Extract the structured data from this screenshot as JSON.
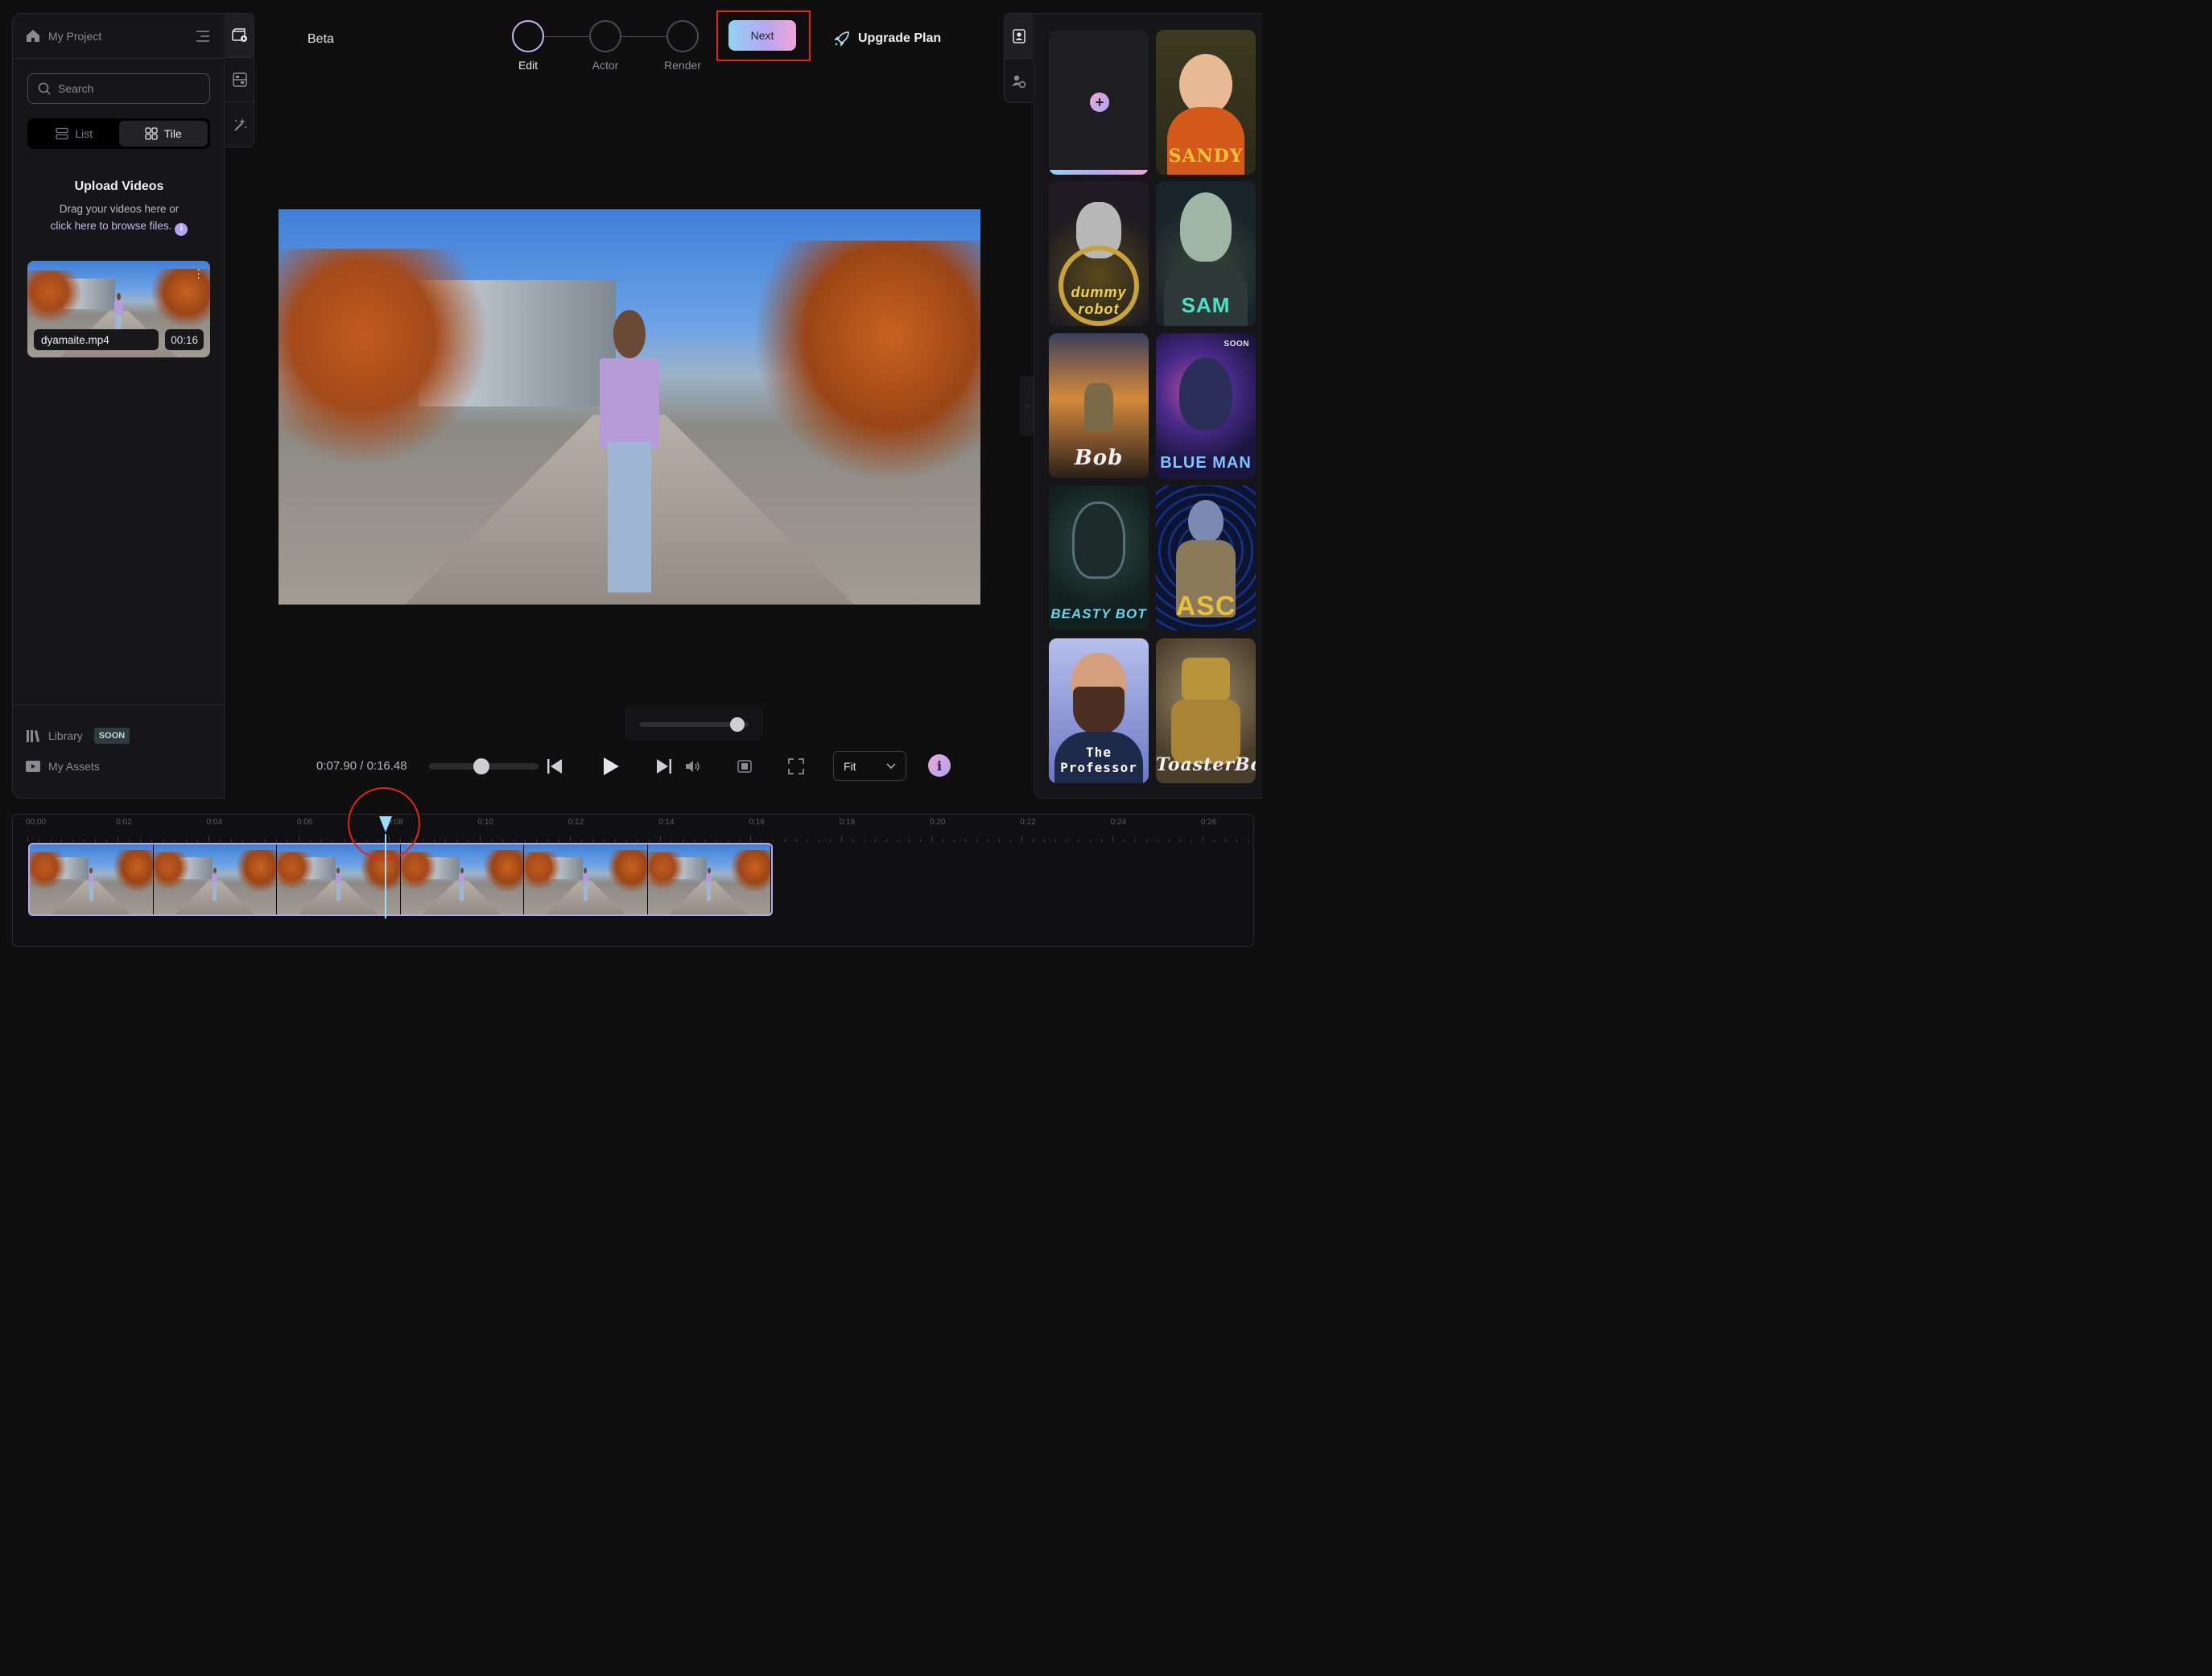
{
  "left_panel": {
    "project_title": "My Project",
    "search_placeholder": "Search",
    "view_toggle": {
      "list_label": "List",
      "tile_label": "Tile",
      "selected": "Tile"
    },
    "upload": {
      "heading": "Upload Videos",
      "line1": "Drag your videos here or",
      "link_text": "click here to browse files."
    },
    "video": {
      "filename": "dyamaite.mp4",
      "duration": "00:16"
    },
    "footer": {
      "library_label": "Library",
      "library_badge": "SOON",
      "assets_label": "My Assets"
    }
  },
  "toolstrip": {
    "items": [
      "video-editor-icon",
      "layout-icon",
      "magic-wand-icon"
    ]
  },
  "header": {
    "beta_label": "Beta",
    "steps": [
      {
        "label": "Edit",
        "active": true
      },
      {
        "label": "Actor",
        "active": false
      },
      {
        "label": "Render",
        "active": false
      }
    ],
    "next_label": "Next",
    "upgrade_label": "Upgrade Plan"
  },
  "player": {
    "time_current": "0:07.90",
    "time_separator": " / ",
    "time_total": "0:16.48",
    "progress_fraction": 0.48,
    "zoom_level_fraction": 0.9,
    "fit_label": "Fit",
    "info_label": "i"
  },
  "actors": {
    "add_label": "+",
    "cards": [
      {
        "name": "SANDY",
        "soon": false,
        "bg": "#2c2a18"
      },
      {
        "name": "dummy robot",
        "soon": false,
        "bg": "#1e1c22"
      },
      {
        "name": "SAM",
        "soon": false,
        "bg": "#18232a"
      },
      {
        "name": "Bob",
        "soon": false,
        "bg": "#8a5a30"
      },
      {
        "name": "BLUE MAN",
        "soon": true,
        "soon_label": "SOON",
        "bg": "#1a1640"
      },
      {
        "name": "BEASTY BOT",
        "soon": false,
        "bg": "#12201f"
      },
      {
        "name": "ASC",
        "soon": false,
        "bg": "#0d1430"
      },
      {
        "name": "The Professor",
        "soon": false,
        "bg": "#6a78c4"
      },
      {
        "name": "ToasterBot",
        "soon": false,
        "bg": "#4a3e2a"
      }
    ]
  },
  "timeline": {
    "ticks": [
      "00:00",
      "0:02",
      "0:04",
      "0:06",
      "0:08",
      "0:10",
      "0:12",
      "0:14",
      "0:16",
      "0:18",
      "0:20",
      "0:22",
      "0:24",
      "0:26"
    ],
    "frame_count": 6
  },
  "colors": {
    "accent_gradient_start": "#8fd5f2",
    "accent_gradient_mid": "#b6a7f2",
    "accent_gradient_end": "#f1a4d6",
    "highlight_red": "#e0271d",
    "playhead": "#9cdcf5"
  }
}
